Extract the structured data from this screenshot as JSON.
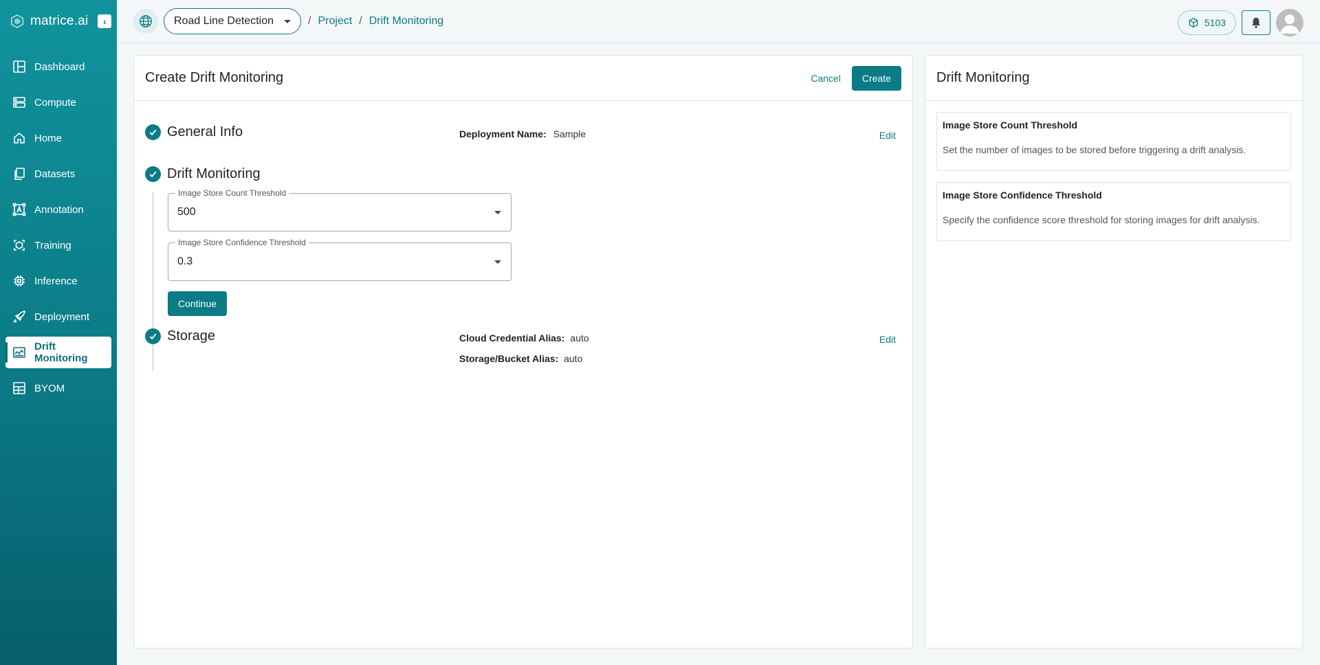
{
  "brand": {
    "logo_text": "matrice.ai"
  },
  "colors": {
    "accent": "#0b7b86",
    "sidebar_top": "#10939d",
    "sidebar_bottom": "#075f6b"
  },
  "sidebar": {
    "items": [
      {
        "label": "Dashboard",
        "icon": "dashboard-icon"
      },
      {
        "label": "Compute",
        "icon": "server-icon"
      },
      {
        "label": "Home",
        "icon": "home-icon"
      },
      {
        "label": "Datasets",
        "icon": "files-icon"
      },
      {
        "label": "Annotation",
        "icon": "annotation-icon"
      },
      {
        "label": "Training",
        "icon": "training-icon"
      },
      {
        "label": "Inference",
        "icon": "chip-icon"
      },
      {
        "label": "Deployment",
        "icon": "rocket-icon"
      },
      {
        "label": "Drift Monitoring",
        "icon": "monitor-chart-icon",
        "active": true
      },
      {
        "label": "BYOM",
        "icon": "model-grid-icon"
      }
    ]
  },
  "header": {
    "project_select": "Road Line Detection",
    "breadcrumb": [
      "Project",
      "Drift Monitoring"
    ],
    "credits": "5103"
  },
  "main": {
    "title": "Create Drift Monitoring",
    "cancel_label": "Cancel",
    "create_label": "Create",
    "steps": {
      "general": {
        "title": "General Info",
        "summary_label": "Deployment Name:",
        "summary_value": "Sample",
        "edit_label": "Edit"
      },
      "drift": {
        "title": "Drift Monitoring",
        "count_field": {
          "label": "Image Store Count Threshold",
          "value": "500"
        },
        "confidence_field": {
          "label": "Image Store Confidence Threshold",
          "value": "0.3"
        },
        "continue_label": "Continue"
      },
      "storage": {
        "title": "Storage",
        "cred_label": "Cloud Credential Alias:",
        "cred_value": "auto",
        "bucket_label": "Storage/Bucket Alias:",
        "bucket_value": "auto",
        "edit_label": "Edit"
      }
    }
  },
  "side": {
    "title": "Drift Monitoring",
    "boxes": [
      {
        "title": "Image Store Count Threshold",
        "desc": "Set the number of images to be stored before triggering a drift analysis."
      },
      {
        "title": "Image Store Confidence Threshold",
        "desc": "Specify the confidence score threshold for storing images for drift analysis."
      }
    ]
  }
}
